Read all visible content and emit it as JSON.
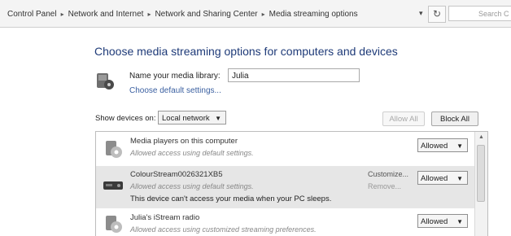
{
  "breadcrumb": {
    "items": [
      "Control Panel",
      "Network and Internet",
      "Network and Sharing Center",
      "Media streaming options"
    ],
    "separator": "▸"
  },
  "address_bar": {
    "dropdown_glyph": "▾",
    "refresh_glyph": "↻",
    "search_placeholder": "Search C"
  },
  "page": {
    "heading": "Choose media streaming options for computers and devices",
    "library_label": "Name your media library:",
    "library_value": "Julia",
    "default_link": "Choose default settings...",
    "show_devices_label": "Show devices on:",
    "network_select": "Local network",
    "allow_all_label": "Allow All",
    "block_all_label": "Block All"
  },
  "devices": [
    {
      "name": "Media players on this computer",
      "status": "Allowed access using default settings.",
      "access": "Allowed",
      "icon": "media-player-icon"
    },
    {
      "name": "ColourStream0026321XB5",
      "status": "Allowed access using default settings.",
      "note": "This device can't access your media when your PC sleeps.",
      "customize": "Customize...",
      "remove": "Remove...",
      "access": "Allowed",
      "icon": "streaming-device-icon"
    },
    {
      "name": "Julia's iStream radio",
      "status": "Allowed access using customized streaming preferences.",
      "access": "Allowed",
      "icon": "radio-icon"
    }
  ],
  "colors": {
    "heading": "#1e3a78",
    "link": "#3a5fa0",
    "selected_row": "#e6e6e6"
  }
}
